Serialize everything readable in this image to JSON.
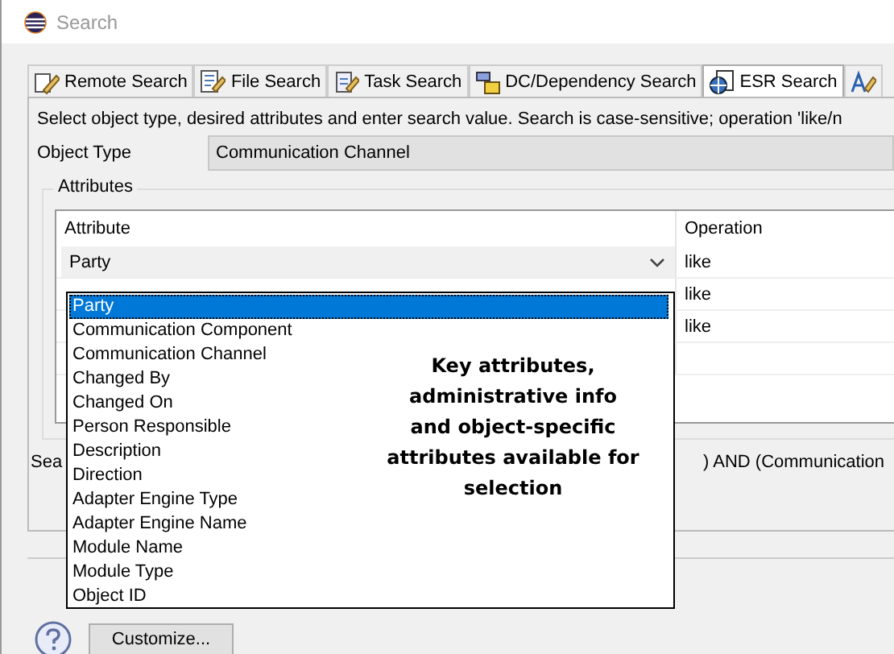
{
  "window": {
    "title": "Search"
  },
  "tabs": [
    {
      "label": "Remote Search",
      "selected": false
    },
    {
      "label": "File Search",
      "selected": false
    },
    {
      "label": "Task Search",
      "selected": false
    },
    {
      "label": "DC/Dependency Search",
      "selected": false
    },
    {
      "label": "ESR Search",
      "selected": true
    },
    {
      "selected": false
    }
  ],
  "instruction": "Select object type, desired attributes and enter search value. Search is case-sensitive; operation 'like/n",
  "object_type": {
    "label": "Object Type",
    "value": "Communication Channel"
  },
  "attributes": {
    "title": "Attributes",
    "columns": [
      "Attribute",
      "Operation"
    ],
    "rows": [
      {
        "attribute": "Party",
        "operation": "like",
        "editing": true
      },
      {
        "attribute": "",
        "operation": "like",
        "editing": false
      },
      {
        "attribute": "",
        "operation": "like",
        "editing": false
      },
      {
        "attribute": "",
        "operation": "",
        "editing": false
      }
    ]
  },
  "search_summary": {
    "start": "Sea",
    "end": ") AND (Communication"
  },
  "dropdown": {
    "items": [
      {
        "label": "Party",
        "selected": true
      },
      {
        "label": "Communication Component",
        "selected": false
      },
      {
        "label": "Communication Channel",
        "selected": false
      },
      {
        "label": "Changed By",
        "selected": false
      },
      {
        "label": "Changed On",
        "selected": false
      },
      {
        "label": "Person Responsible",
        "selected": false
      },
      {
        "label": "Description",
        "selected": false
      },
      {
        "label": "Direction",
        "selected": false
      },
      {
        "label": "Adapter Engine Type",
        "selected": false
      },
      {
        "label": "Adapter Engine Name",
        "selected": false
      },
      {
        "label": "Module Name",
        "selected": false
      },
      {
        "label": "Module Type",
        "selected": false
      },
      {
        "label": "Object ID",
        "selected": false
      }
    ],
    "note": "Key attributes, administrative info and object-specific attributes available for selection"
  },
  "footer": {
    "button": "Customize..."
  }
}
